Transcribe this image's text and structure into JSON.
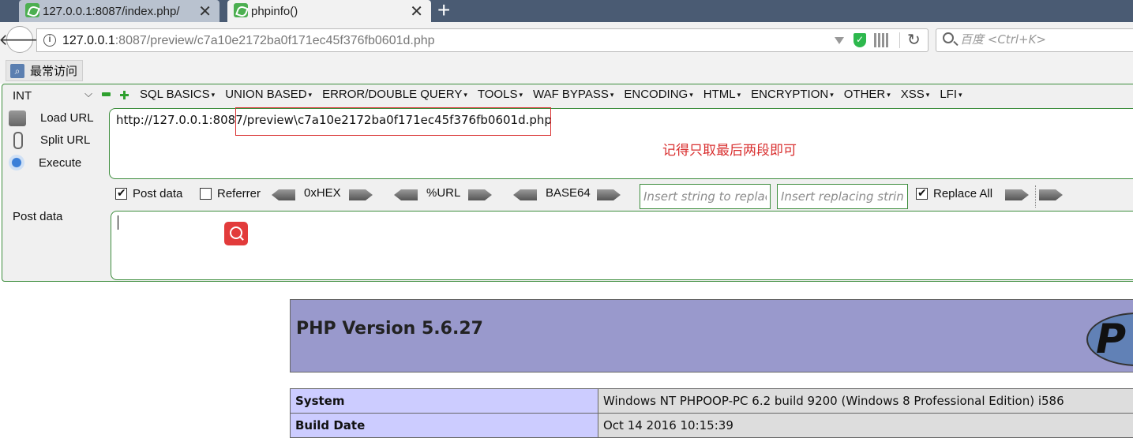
{
  "tabs": [
    {
      "title": "127.0.0.1:8087/index.php/"
    },
    {
      "title": "phpinfo()"
    }
  ],
  "newtab_symbol": "+",
  "close_symbol": "✕",
  "address": {
    "host": "127.0.0.1",
    "rest": ":8087/preview/c7a10e2172ba0f171ec45f376fb0601d.php"
  },
  "search": {
    "placeholder": "百度 <Ctrl+K>"
  },
  "bookmarks": {
    "most_visited": "最常访问"
  },
  "hackbar": {
    "select_value": "INT",
    "menu": [
      "SQL BASICS",
      "UNION BASED",
      "ERROR/DOUBLE QUERY",
      "TOOLS",
      "WAF BYPASS",
      "ENCODING",
      "HTML",
      "ENCRYPTION",
      "OTHER",
      "XSS",
      "LFI"
    ],
    "load_url": "Load URL",
    "split_url": "Split URL",
    "execute": "Execute",
    "url_value": "http://127.0.0.1:8087/preview\\c7a10e2172ba0f171ec45f376fb0601d.php",
    "annotation": "记得只取最后两段即可",
    "post_data_checkbox": "Post data",
    "post_data_checked": true,
    "referrer_checkbox": "Referrer",
    "referrer_checked": false,
    "hex_label": "0xHEX",
    "url_label": "%URL",
    "base64_label": "BASE64",
    "replace_find_placeholder": "Insert string to replace",
    "replace_with_placeholder": "Insert replacing string",
    "replace_all": "Replace All",
    "replace_all_checked": true,
    "post_data_label": "Post data",
    "post_data_value": ""
  },
  "phpinfo": {
    "title": "PHP Version 5.6.27",
    "logo_text": "P",
    "rows": [
      {
        "key": "System",
        "value": "Windows NT PHPOOP-PC 6.2 build 9200 (Windows 8 Professional Edition) i586"
      },
      {
        "key": "Build Date",
        "value": "Oct 14 2016 10:15:39"
      }
    ]
  },
  "colors": {
    "tabstrip": "#4a5b73",
    "hackbar_border": "#3d8d3d",
    "annotation_red": "#d93030",
    "php_header": "#9999cc",
    "php_key_bg": "#ccccff"
  }
}
